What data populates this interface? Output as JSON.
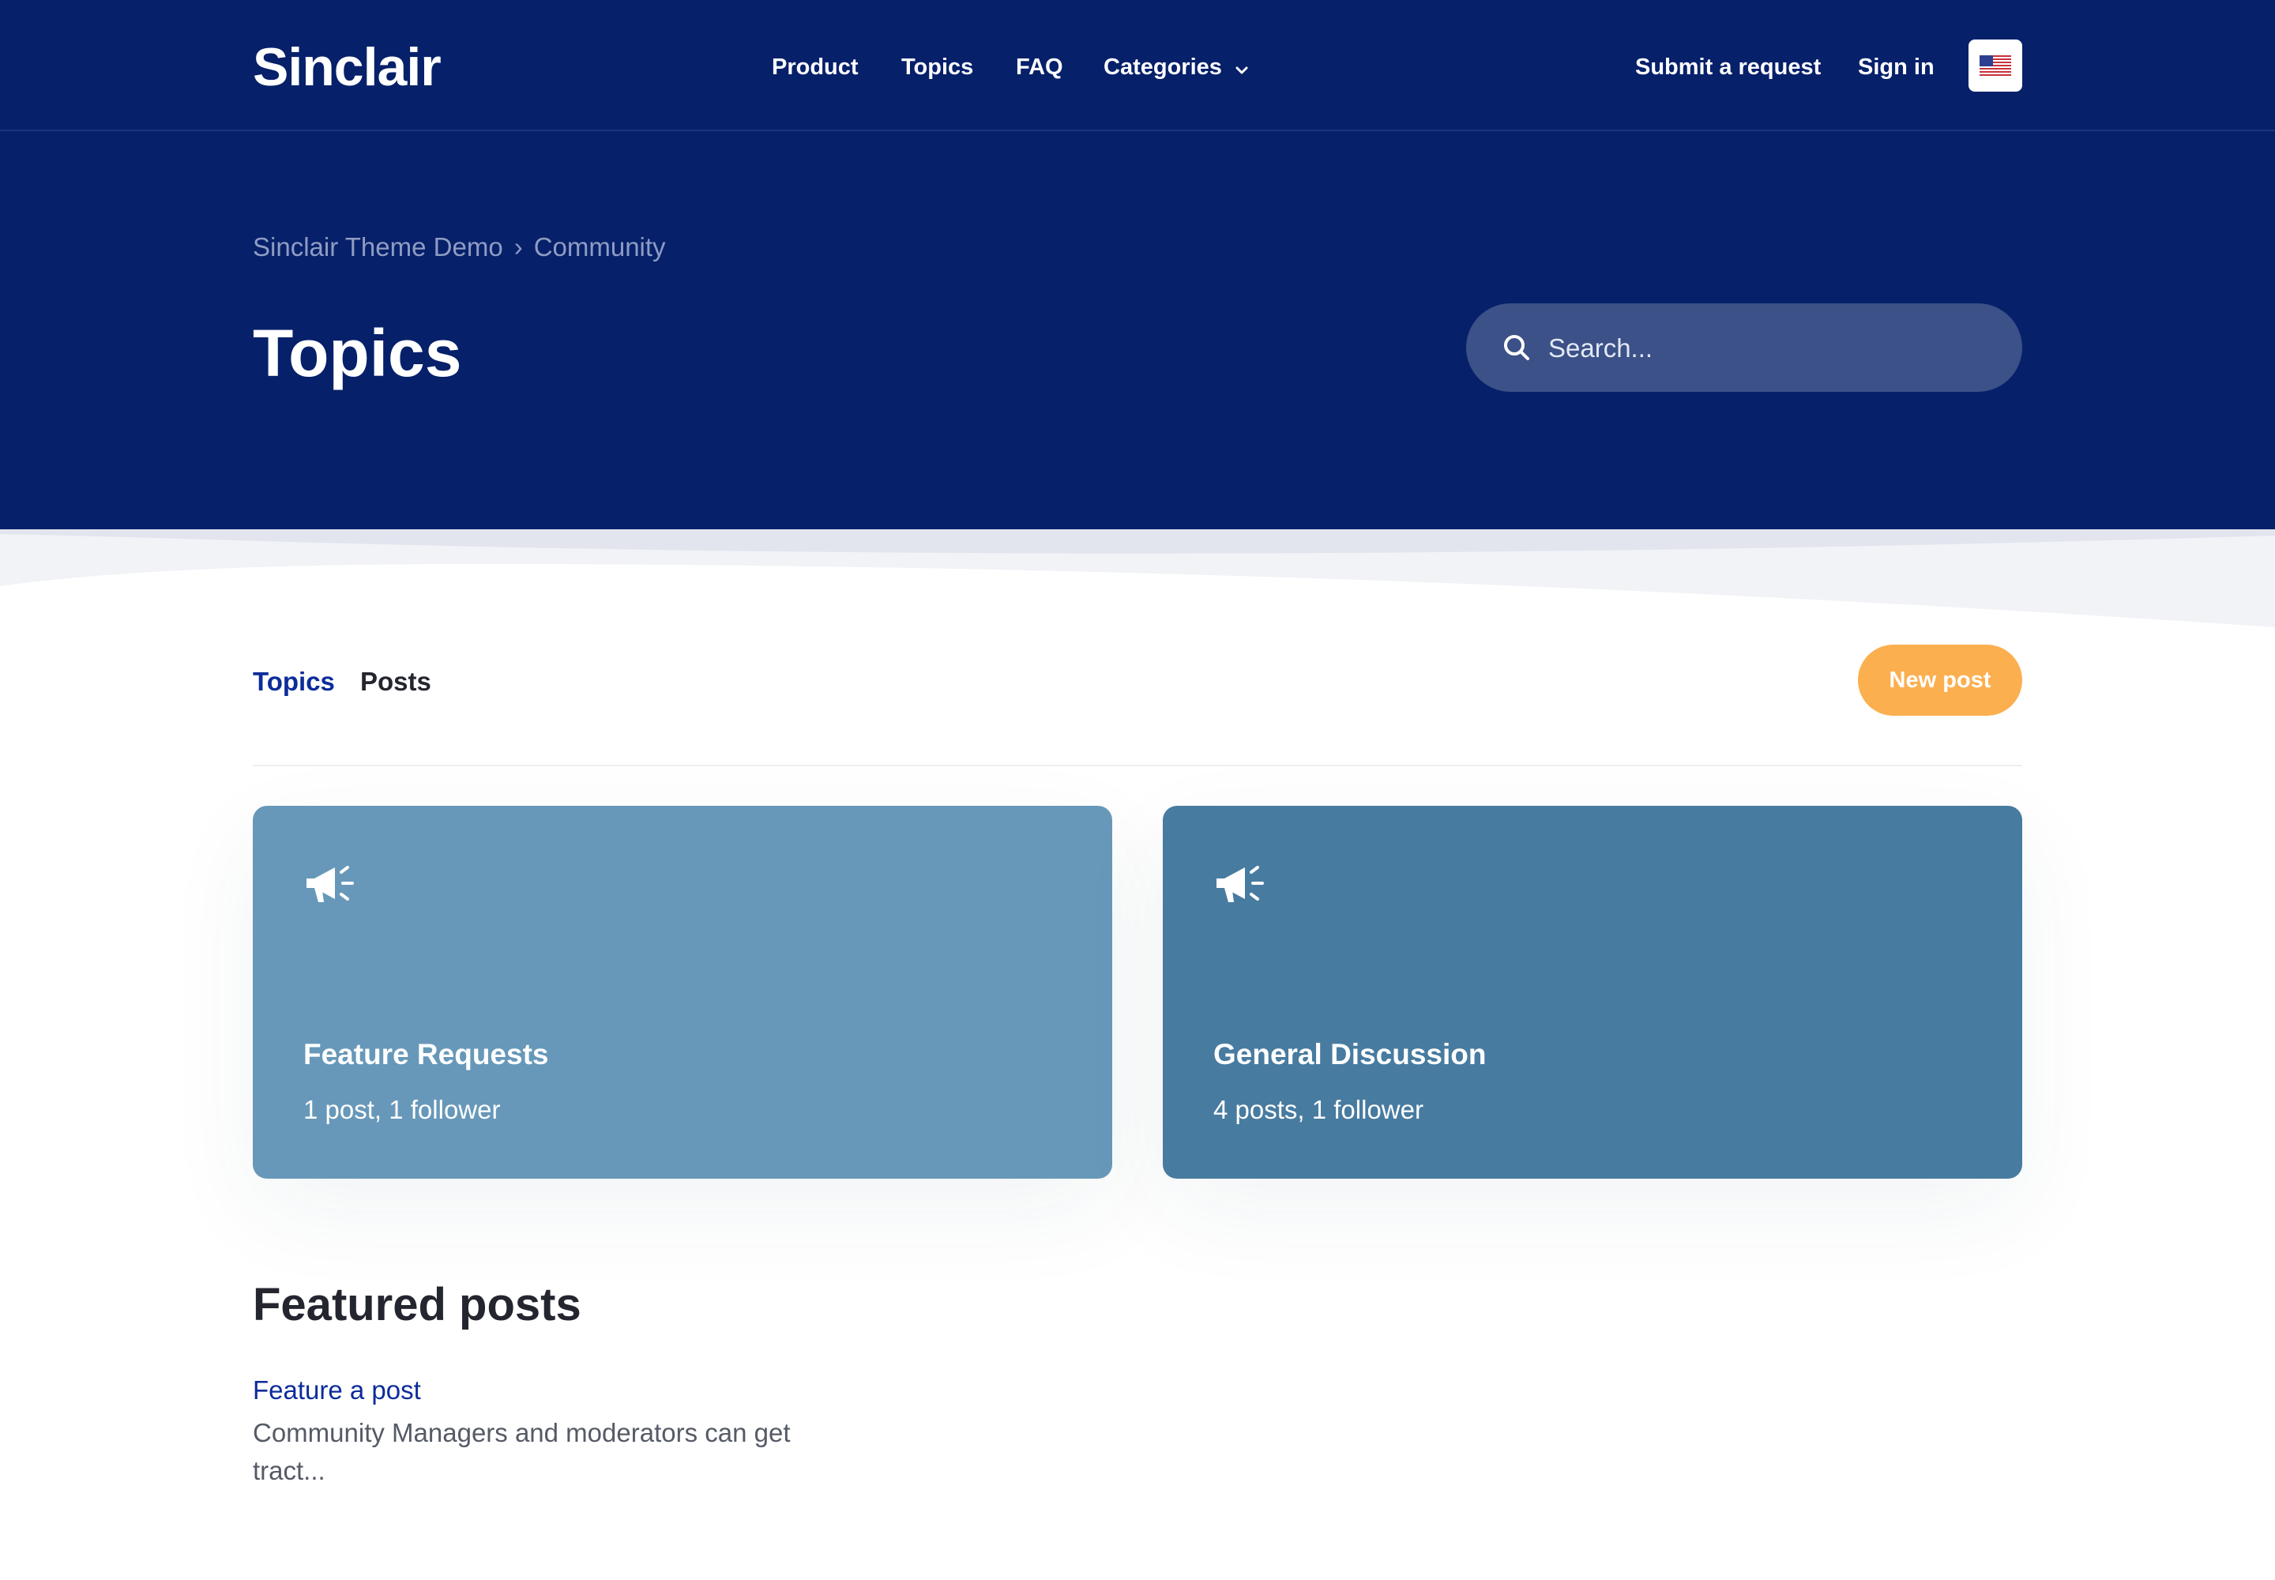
{
  "header": {
    "logo": "Sinclair",
    "nav": {
      "product": "Product",
      "topics": "Topics",
      "faq": "FAQ",
      "categories": "Categories"
    },
    "submit_request": "Submit a request",
    "sign_in": "Sign in",
    "language_icon": "us-flag-icon"
  },
  "hero": {
    "breadcrumb": [
      "Sinclair Theme Demo",
      "Community"
    ],
    "breadcrumb_separator": "›",
    "title": "Topics",
    "search_placeholder": "Search..."
  },
  "tabs": {
    "topics": "Topics",
    "posts": "Posts",
    "active": "Topics"
  },
  "new_post_label": "New post",
  "topic_cards": [
    {
      "title": "Feature Requests",
      "meta": "1 post, 1 follower",
      "color": "#6798b9",
      "icon": "megaphone-icon"
    },
    {
      "title": "General Discussion",
      "meta": "4 posts, 1 follower",
      "color": "#487ba0",
      "icon": "megaphone-icon"
    }
  ],
  "featured": {
    "heading": "Featured posts",
    "posts": [
      {
        "title": "Feature a post",
        "excerpt": "Community Managers and moderators can get tract..."
      }
    ]
  },
  "colors": {
    "hero_bg": "#06206a",
    "accent_orange": "#fbaf4f",
    "link_blue": "#0c2c9a",
    "active_tab": "#0c2c9a"
  }
}
